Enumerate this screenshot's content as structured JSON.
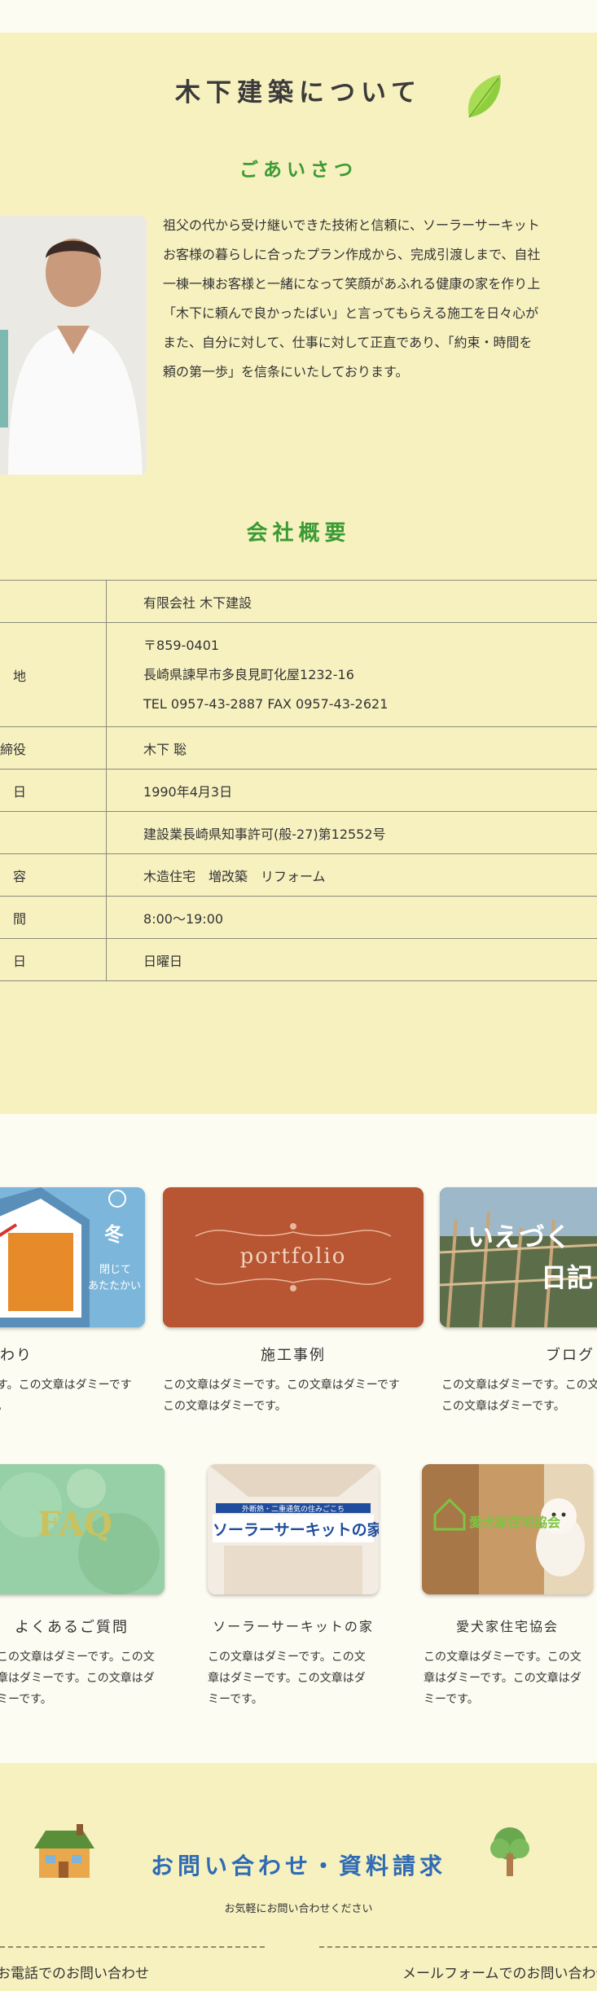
{
  "about": {
    "title": "木下建築について",
    "greeting_heading": "ごあいさつ",
    "greeting_lines": [
      "祖父の代から受け継いできた技術と信頼に、ソーラーサーキット",
      "お客様の暮らしに合ったプラン作成から、完成引渡しまで、自社",
      "一棟一棟お客様と一緒になって笑顔があふれる健康の家を作り上",
      "「木下に頼んで良かったばい」と言ってもらえる施工を日々心が",
      "また、自分に対して、仕事に対して正直であり、「約束・時間を",
      "頼の第一歩」を信条にいたしております。"
    ],
    "company_heading": "会社概要",
    "table": [
      {
        "key": "",
        "value": "有限会社 木下建設"
      },
      {
        "key": "地",
        "address": [
          "〒859-0401",
          "長崎県諫早市多良見町化屋1232-16",
          "TEL 0957-43-2887  FAX 0957-43-2621"
        ]
      },
      {
        "key": "締役",
        "value": "木下 聡"
      },
      {
        "key": "日",
        "value": "1990年4月3日"
      },
      {
        "key": "",
        "value": "建設業長崎県知事許可(般-27)第12552号"
      },
      {
        "key": "容",
        "value": "木造住宅　増改築　リフォーム"
      },
      {
        "key": "間",
        "value": "8:00〜19:00"
      },
      {
        "key": "日",
        "value": "日曜日"
      }
    ]
  },
  "cards_row1": [
    {
      "title": "だわり",
      "image_text": [
        "冬",
        "閉じて",
        "あたたかい"
      ],
      "desc": [
        "す。この文章はダミーです",
        "。"
      ]
    },
    {
      "title": "施工事例",
      "image_text": [
        "portfolio"
      ],
      "desc": [
        "この文章はダミーです。この文章はダミーです",
        "この文章はダミーです。"
      ]
    },
    {
      "title": "ブログ",
      "image_text": [
        "いえづく",
        "日記"
      ],
      "desc": [
        "この文章はダミーです。この文",
        "この文章はダミーです。"
      ]
    }
  ],
  "cards_row2": [
    {
      "title": "よくあるご質問",
      "image_text": [
        "FAQ"
      ],
      "desc": [
        "この文章はダミーです。この文",
        "章はダミーです。この文章はダ",
        "ミーです。"
      ]
    },
    {
      "title": "ソーラーサーキットの家",
      "image_text": [
        "外断熱・二重通気の住みごこち",
        "ソーラーサーキットの家"
      ],
      "desc": [
        "この文章はダミーです。この文",
        "章はダミーです。この文章はダ",
        "ミーです。"
      ]
    },
    {
      "title": "愛犬家住宅協会",
      "image_text": [
        "愛犬家住宅協会"
      ],
      "desc": [
        "この文章はダミーです。この文",
        "章はダミーです。この文章はダ",
        "ミーです。"
      ]
    }
  ],
  "contact": {
    "title": "お問い合わせ・資料請求",
    "subtitle": "お気軽にお問い合わせください",
    "phone_label": "お電話でのお問い合わせ",
    "mail_label": "メールフォームでのお問い合わせ"
  },
  "colors": {
    "yellow_band": "#f7f1c0",
    "green_heading": "#3a9a33",
    "blue_heading": "#2f6bb4"
  }
}
